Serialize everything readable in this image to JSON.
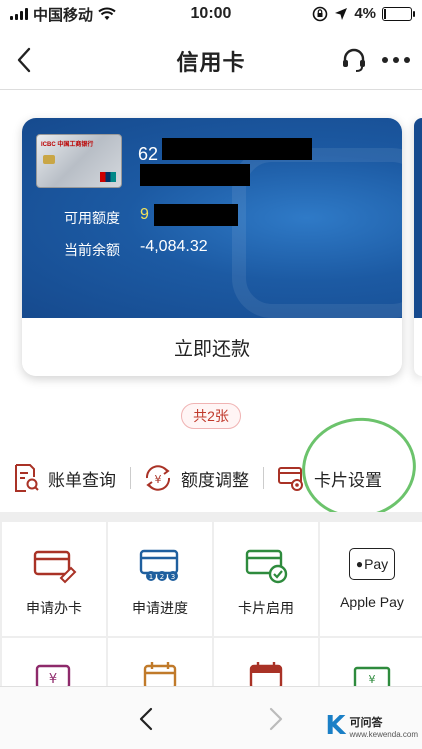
{
  "status_bar": {
    "carrier": "中国移动",
    "time": "10:00",
    "battery": "4%"
  },
  "header": {
    "title": "信用卡"
  },
  "card": {
    "number_prefix": "62",
    "available_label": "可用额度",
    "available_prefix": "9",
    "balance_label": "当前余额",
    "balance_value": "-4,084.32",
    "repay_button": "立即还款",
    "thumb_bank": "ICBC 中国工商银行"
  },
  "card_count": "共2张",
  "quick_actions": [
    {
      "label": "账单查询",
      "icon": "bill-search-icon"
    },
    {
      "label": "额度调整",
      "icon": "limit-adjust-icon"
    },
    {
      "label": "卡片设置",
      "icon": "card-settings-icon"
    }
  ],
  "grid_items": [
    {
      "label": "申请办卡",
      "icon": "apply-card-icon"
    },
    {
      "label": "申请进度",
      "icon": "apply-progress-icon"
    },
    {
      "label": "卡片启用",
      "icon": "card-activate-icon"
    },
    {
      "label": "Apple Pay",
      "icon": "apple-pay-icon"
    }
  ],
  "apple_pay_badge": "Pay",
  "watermark": {
    "letter": "K",
    "name": "可问答",
    "url": "www.kewenda.com"
  },
  "colors": {
    "accent_red": "#a93226",
    "card_blue": "#1c5aa3",
    "available_yellow": "#f3e25a",
    "annotation_green": "#6cc36c",
    "icon_blue": "#1f5f9e",
    "icon_green": "#2e8b3d"
  }
}
